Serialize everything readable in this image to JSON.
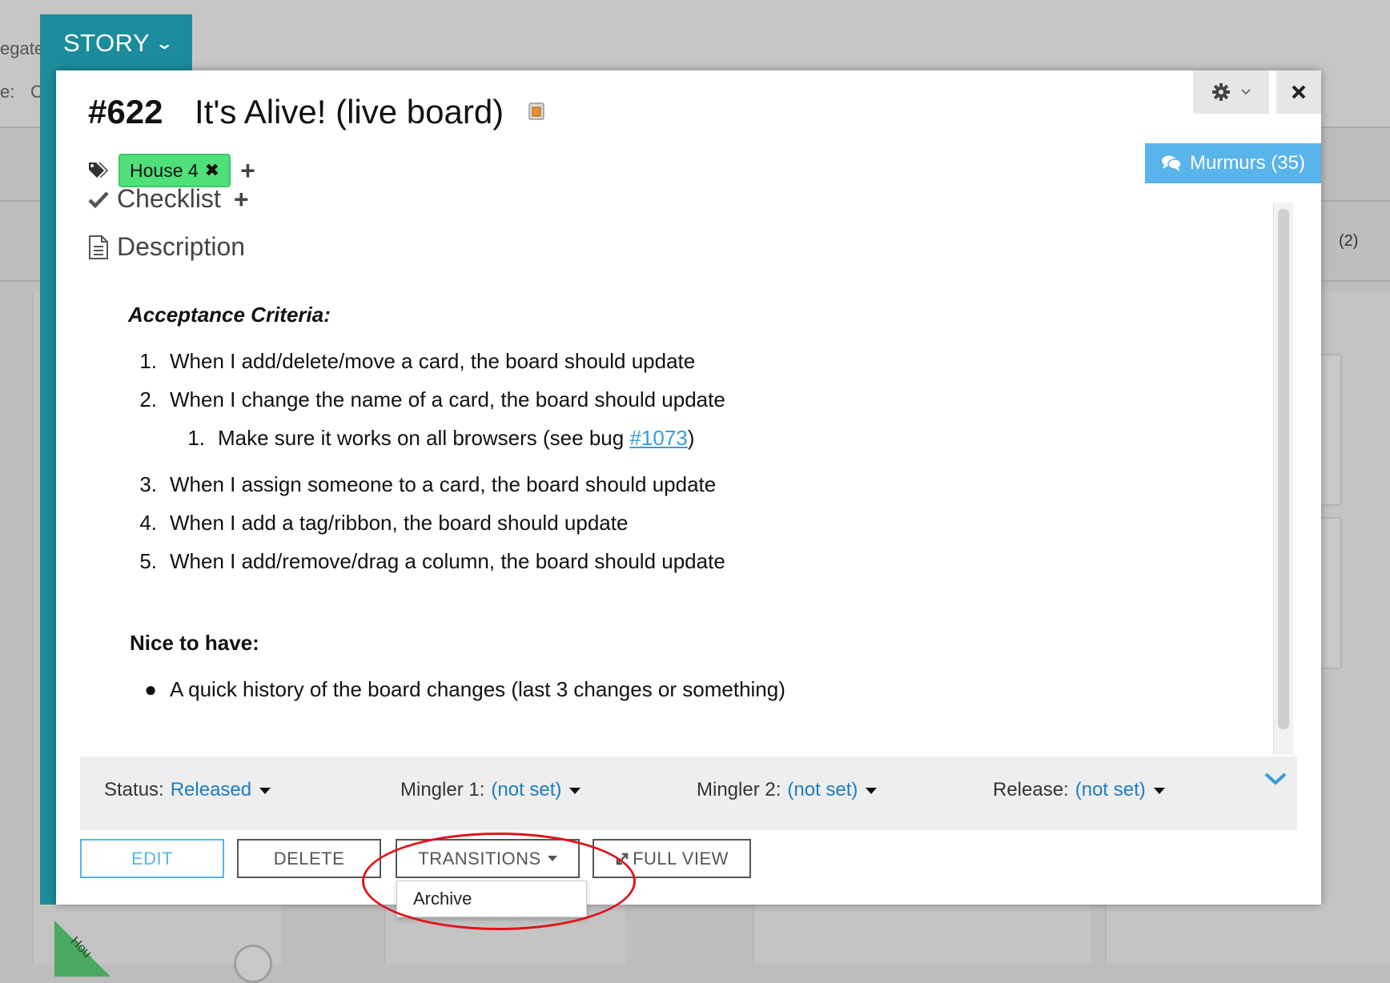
{
  "background": {
    "left_text_1": "egate",
    "left_text_2": "e:",
    "left_text_3": "C",
    "right_count": "(2)",
    "ribbon_text": "Hou"
  },
  "story_tab": {
    "label": "STORY"
  },
  "card": {
    "number": "#622",
    "title": "It's Alive! (live board)"
  },
  "header_buttons": {
    "murmurs_label": "Murmurs (35)"
  },
  "tags": [
    {
      "label": "House 4"
    }
  ],
  "sections": {
    "checklist": "Checklist",
    "description": "Description"
  },
  "description": {
    "acceptance_heading": "Acceptance Criteria:",
    "items": [
      {
        "num": "1.",
        "text": "When I add/delete/move a card, the board should update"
      },
      {
        "num": "2.",
        "text": "When I change the name of a card, the board should update"
      },
      {
        "num": "3.",
        "text": "When I assign someone to a card, the board should update"
      },
      {
        "num": "4.",
        "text": "When I add a tag/ribbon, the board should update"
      },
      {
        "num": "5.",
        "text": "When I add/remove/drag a column, the board should update"
      }
    ],
    "sub_item": {
      "num": "1.",
      "text_before": "Make sure it works on all browsers (see bug ",
      "link": "#1073",
      "text_after": ")"
    },
    "nice_heading": "Nice to have:",
    "bullet": "A quick history of the board changes (last 3 changes or something)"
  },
  "properties": [
    {
      "label": "Status:",
      "value": "Released"
    },
    {
      "label": "Mingler 1:",
      "value": "(not set)"
    },
    {
      "label": "Mingler 2:",
      "value": "(not set)"
    },
    {
      "label": "Release:",
      "value": "(not set)"
    }
  ],
  "actions": {
    "edit": "EDIT",
    "delete": "DELETE",
    "transitions": "TRANSITIONS",
    "full_view": "FULL VIEW"
  },
  "transitions_menu": {
    "items": [
      "Archive"
    ]
  },
  "colors": {
    "accent_teal": "#1c8c9c",
    "murmurs_blue": "#58b4ea",
    "tag_green": "#4fe07a",
    "link_blue": "#1a7dc4",
    "highlight_red": "#e0141b"
  }
}
